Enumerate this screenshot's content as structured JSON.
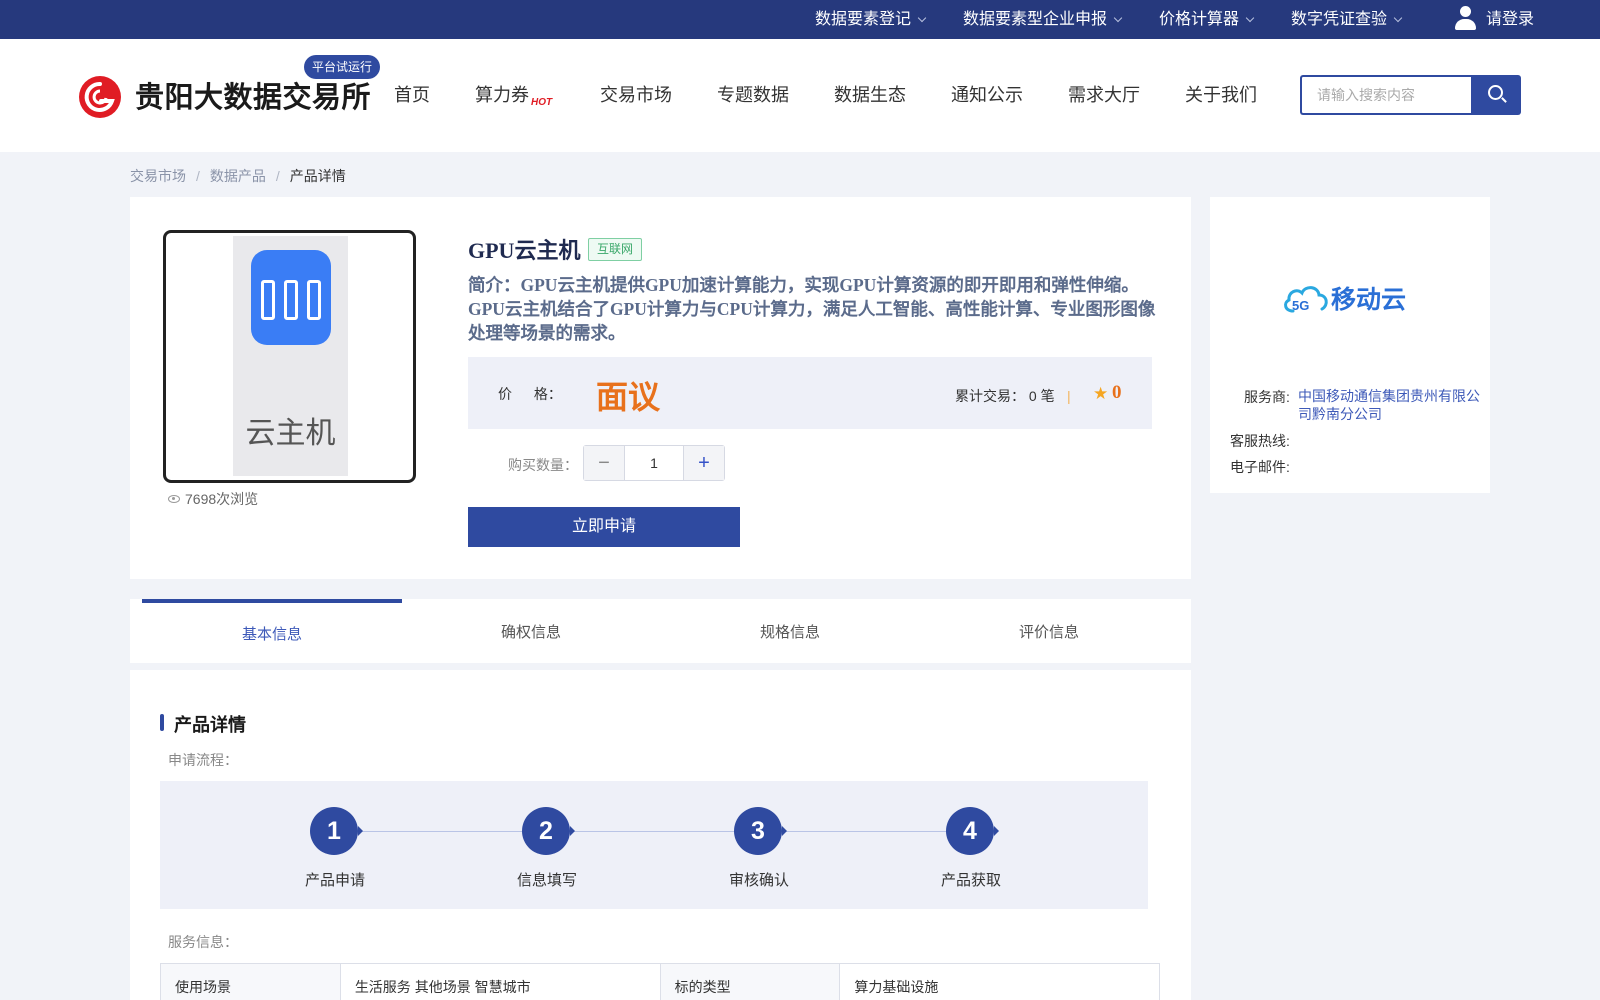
{
  "topbar": {
    "items": [
      {
        "label": "数据要素登记"
      },
      {
        "label": "数据要素型企业申报"
      },
      {
        "label": "价格计算器"
      },
      {
        "label": "数字凭证查验"
      }
    ],
    "login_label": "请登录"
  },
  "header": {
    "logo_text": "贵阳大数据交易所",
    "badge": "平台试运行",
    "nav": [
      {
        "label": "首页"
      },
      {
        "label": "算力券",
        "badge": "HOT"
      },
      {
        "label": "交易市场"
      },
      {
        "label": "专题数据"
      },
      {
        "label": "数据生态"
      },
      {
        "label": "通知公示"
      },
      {
        "label": "需求大厅"
      },
      {
        "label": "关于我们"
      }
    ],
    "search_placeholder": "请输入搜索内容"
  },
  "breadcrumb": [
    "交易市场",
    "数据产品",
    "产品详情"
  ],
  "product": {
    "image_caption": "云主机",
    "views": "7698次浏览",
    "title": "GPU云主机",
    "tag": "互联网",
    "description": "简介：GPU云主机提供GPU加速计算能力，实现GPU计算资源的即开即用和弹性伸缩。GPU云主机结合了GPU计算力与CPU计算力，满足人工智能、高性能计算、专业图形图像处理等场景的需求。",
    "price_label": "价 格：",
    "price_value": "面议",
    "trade_count": "累计交易：  0 笔",
    "divider": "|",
    "rating": "0",
    "qty_label": "购买数量：",
    "qty_value": "1",
    "minus": "−",
    "plus": "+",
    "apply_label": "立即申请"
  },
  "vendor": {
    "logo_text": "移动云",
    "logo_badge": "5G",
    "provider_label": "服务商:",
    "provider_value": "中国移动通信集团贵州有限公司黔南分公司",
    "hotline_label": "客服热线:",
    "email_label": "电子邮件:"
  },
  "tabs": [
    {
      "label": "基本信息"
    },
    {
      "label": "确权信息"
    },
    {
      "label": "规格信息"
    },
    {
      "label": "评价信息"
    }
  ],
  "detail": {
    "section_title": "产品详情",
    "flow_label": "申请流程：",
    "steps": [
      {
        "num": "1",
        "label": "产品申请"
      },
      {
        "num": "2",
        "label": "信息填写"
      },
      {
        "num": "3",
        "label": "审核确认"
      },
      {
        "num": "4",
        "label": "产品获取"
      }
    ],
    "service_label": "服务信息：",
    "table": [
      {
        "k1": "使用场景",
        "v1": "生活服务 其他场景 智慧城市",
        "k2": "标的类型",
        "v2": "算力基础设施"
      }
    ]
  },
  "colors": {
    "primary": "#2f4aa0",
    "topbar": "#26397d",
    "price": "#e8711c",
    "brand_red": "#e01c24"
  }
}
